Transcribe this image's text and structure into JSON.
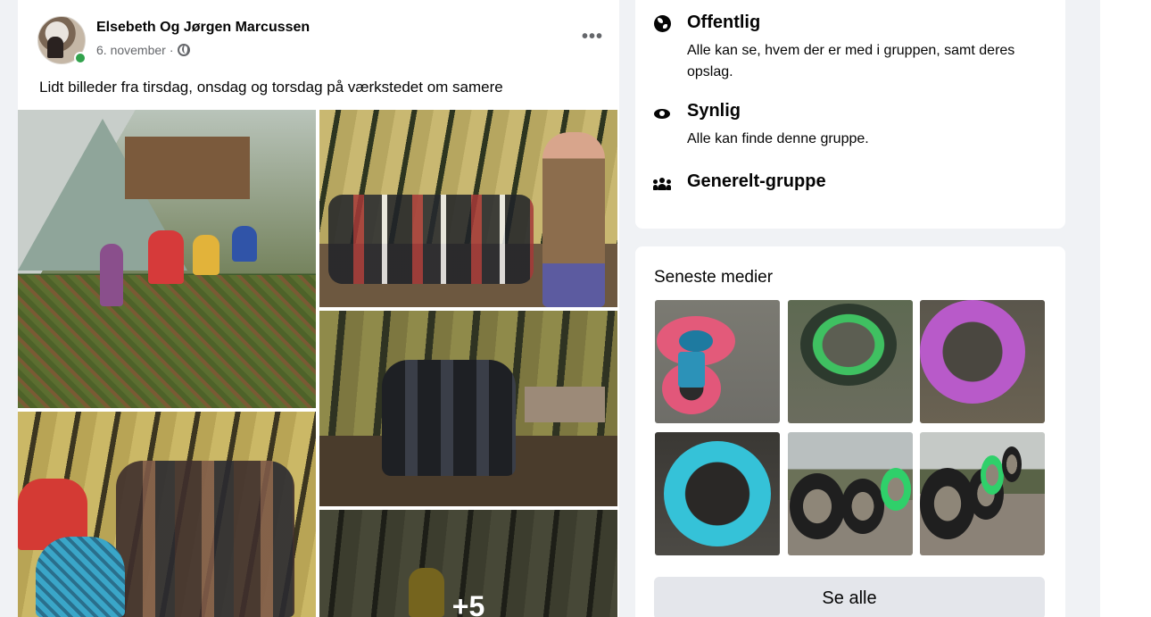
{
  "post": {
    "author": "Elsebeth Og Jørgen Marcussen",
    "date": "6. november",
    "separator": "·",
    "more_label": "•••",
    "text": "Lidt billeder fra tirsdag, onsdag og torsdag på værkstedet om samere",
    "more_photos_label": "+5",
    "icons": {
      "privacy": "globe-icon",
      "more": "more-options-icon"
    },
    "colors": {
      "online": "#31a24c"
    }
  },
  "about": {
    "items": [
      {
        "title": "Offentlig",
        "description": "Alle kan se, hvem der er med i gruppen, samt deres opslag.",
        "icon": "globe-icon"
      },
      {
        "title": "Synlig",
        "description": "Alle kan finde denne gruppe.",
        "icon": "eye-icon"
      },
      {
        "title": "Generelt-gruppe",
        "description": "",
        "icon": "people-icon"
      }
    ]
  },
  "media": {
    "title": "Seneste medier",
    "see_all_label": "Se alle"
  }
}
